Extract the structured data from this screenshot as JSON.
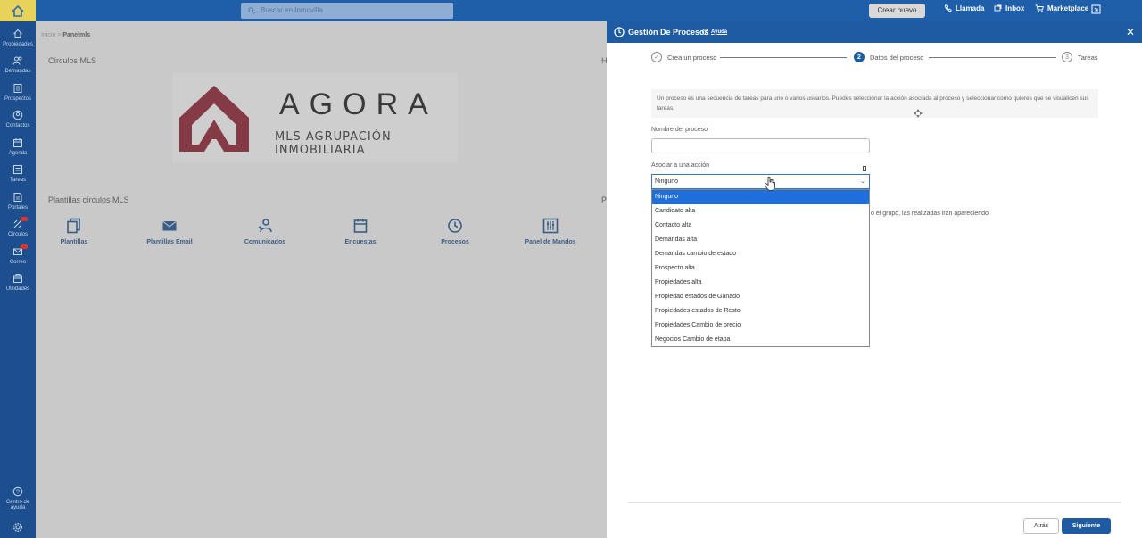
{
  "topbar": {
    "search_placeholder": "Buscar en Inmovilla",
    "create_button": "Crear nuevo",
    "call_label": "Llamada",
    "inbox_label": "Inbox",
    "marketplace_label": "Marketplace"
  },
  "sidebar": {
    "items": [
      {
        "label": "Propiedades",
        "icon": "home-icon"
      },
      {
        "label": "Demandas",
        "icon": "users-icon"
      },
      {
        "label": "Prospectos",
        "icon": "building-icon"
      },
      {
        "label": "Contactos",
        "icon": "contact-icon"
      },
      {
        "label": "Agenda",
        "icon": "calendar-icon"
      },
      {
        "label": "Tareas",
        "icon": "tasks-icon"
      },
      {
        "label": "Portales",
        "icon": "portal-icon"
      },
      {
        "label": "Círculos",
        "icon": "circles-icon"
      },
      {
        "label": "Correo",
        "icon": "mail-icon"
      },
      {
        "label": "Utilidades",
        "icon": "tools-icon"
      }
    ],
    "help_label_1": "Centro de",
    "help_label_2": "ayuda"
  },
  "main": {
    "breadcrumb_home": "Inicio",
    "breadcrumb_sep": ">",
    "breadcrumb_current": "Panelmls",
    "section_circles": "Círculos MLS",
    "section_h": "H",
    "logo_name": "AGORA",
    "logo_sub": "MLS AGRUPACIÓN INMOBILIARIA",
    "section_templates": "Plantillas círculos MLS",
    "section_p": "P",
    "tiles": [
      {
        "label": "Plantillas",
        "icon": "templates-icon"
      },
      {
        "label": "Plantillas Email",
        "icon": "email-icon"
      },
      {
        "label": "Comunicados",
        "icon": "announcement-icon"
      },
      {
        "label": "Encuestas",
        "icon": "survey-icon"
      },
      {
        "label": "Procesos",
        "icon": "clock-icon"
      },
      {
        "label": "Panel de Mandos",
        "icon": "dashboard-icon"
      }
    ]
  },
  "panel": {
    "title": "Gestión De Procesos",
    "help_label": "Ayuda",
    "steps": [
      {
        "num": "✓",
        "label": "Crea un proceso",
        "state": "done"
      },
      {
        "num": "2",
        "label": "Datos del proceso",
        "state": "active"
      },
      {
        "num": "3",
        "label": "Tareas",
        "state": "pending"
      }
    ],
    "info_text": "Un proceso es una secuencia de tareas para uno o varios usuarios. Puedes seleccionar la acción asociada al proceso y seleccionar como quieres que se visualicen sus tareas.",
    "name_label": "Nombre del proceso",
    "name_value": "",
    "action_label": "Asociar a una acción",
    "action_selected": "Ninguno",
    "action_options": [
      "Ninguno",
      "Candidato alta",
      "Contacto alta",
      "Demandas alta",
      "Demandas cambio de estado",
      "Prospecto alta",
      "Propiedades alta",
      "Propiedad estados de Ganado",
      "Propiedades estados de Resto",
      "Propiedades Cambio de precio",
      "Negocios Cambio de etapa"
    ],
    "behind_text": "o el grupo, las realizadas irán apareciendo",
    "back_button": "Atrás",
    "next_button": "Siguiente"
  },
  "colors": {
    "primary": "#1e5ba3",
    "sidebar": "#1d4f8f",
    "selected_option": "#1e6fd9",
    "logo_red": "#8b1e2e"
  }
}
